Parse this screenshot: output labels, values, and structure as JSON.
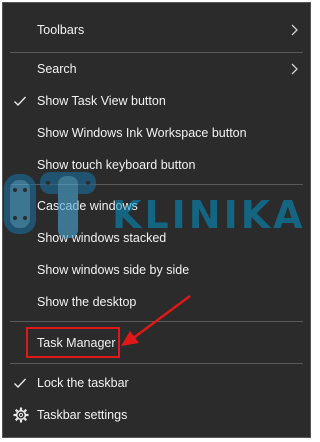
{
  "menu": {
    "items": [
      {
        "label": "Toolbars",
        "has_submenu": true,
        "checked": false
      },
      {
        "label": "Search",
        "has_submenu": true,
        "checked": false
      },
      {
        "label": "Show Task View button",
        "has_submenu": false,
        "checked": true
      },
      {
        "label": "Show Windows Ink Workspace button",
        "has_submenu": false,
        "checked": false
      },
      {
        "label": "Show touch keyboard button",
        "has_submenu": false,
        "checked": false
      },
      {
        "label": "Cascade windows",
        "has_submenu": false,
        "checked": false
      },
      {
        "label": "Show windows stacked",
        "has_submenu": false,
        "checked": false
      },
      {
        "label": "Show windows side by side",
        "has_submenu": false,
        "checked": false
      },
      {
        "label": "Show the desktop",
        "has_submenu": false,
        "checked": false
      },
      {
        "label": "Task Manager",
        "has_submenu": false,
        "checked": false
      },
      {
        "label": "Lock the taskbar",
        "has_submenu": false,
        "checked": true
      },
      {
        "label": "Taskbar settings",
        "has_submenu": false,
        "checked": false,
        "icon": "gear-icon"
      }
    ]
  },
  "watermark": {
    "text": "KLINIKA"
  },
  "colors": {
    "menu_bg": "#2b2b2b",
    "text": "#f2f2f2",
    "separator": "#5a5a5a",
    "annotation_red": "#e01818",
    "watermark": "#0096c8"
  }
}
